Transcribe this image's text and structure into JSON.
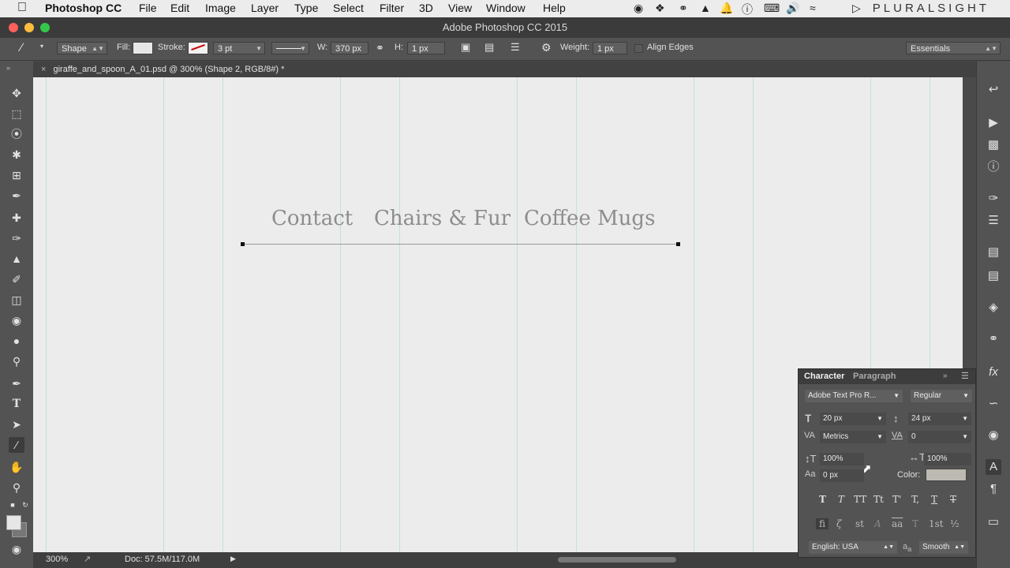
{
  "menubar": {
    "app": "Photoshop CC",
    "items": [
      "File",
      "Edit",
      "Image",
      "Layer",
      "Type",
      "Select",
      "Filter",
      "3D",
      "View",
      "Window",
      "Help"
    ],
    "brand": "PLURALSIGHT"
  },
  "window": {
    "title": "Adobe Photoshop CC 2015"
  },
  "options": {
    "mode": "Shape",
    "fill_label": "Fill:",
    "stroke_label": "Stroke:",
    "stroke_size": "3 pt",
    "w_label": "W:",
    "w_value": "370 px",
    "h_label": "H:",
    "h_value": "1 px",
    "weight_label": "Weight:",
    "weight_value": "1 px",
    "align_edges": "Align Edges",
    "workspace": "Essentials"
  },
  "document": {
    "tab_title": "giraffe_and_spoon_A_01.psd @ 300% (Shape 2, RGB/8#) *",
    "nav": [
      "Contact",
      "Chairs & Fur",
      "Coffee Mugs"
    ]
  },
  "status": {
    "zoom": "300%",
    "doc": "Doc: 57.5M/117.0M"
  },
  "character_panel": {
    "tabs": [
      "Character",
      "Paragraph"
    ],
    "font_family": "Adobe Text Pro R...",
    "font_style": "Regular",
    "font_size": "20 px",
    "leading": "24 px",
    "kerning": "Metrics",
    "tracking": "0",
    "vertical_scale": "100%",
    "horizontal_scale": "100%",
    "baseline_shift": "0 px",
    "color_label": "Color:",
    "color": "#bcbab2",
    "language": "English: USA",
    "aa_label": "a",
    "antialias": "Smooth"
  },
  "icons": {
    "accent": "#9fd3cf"
  }
}
